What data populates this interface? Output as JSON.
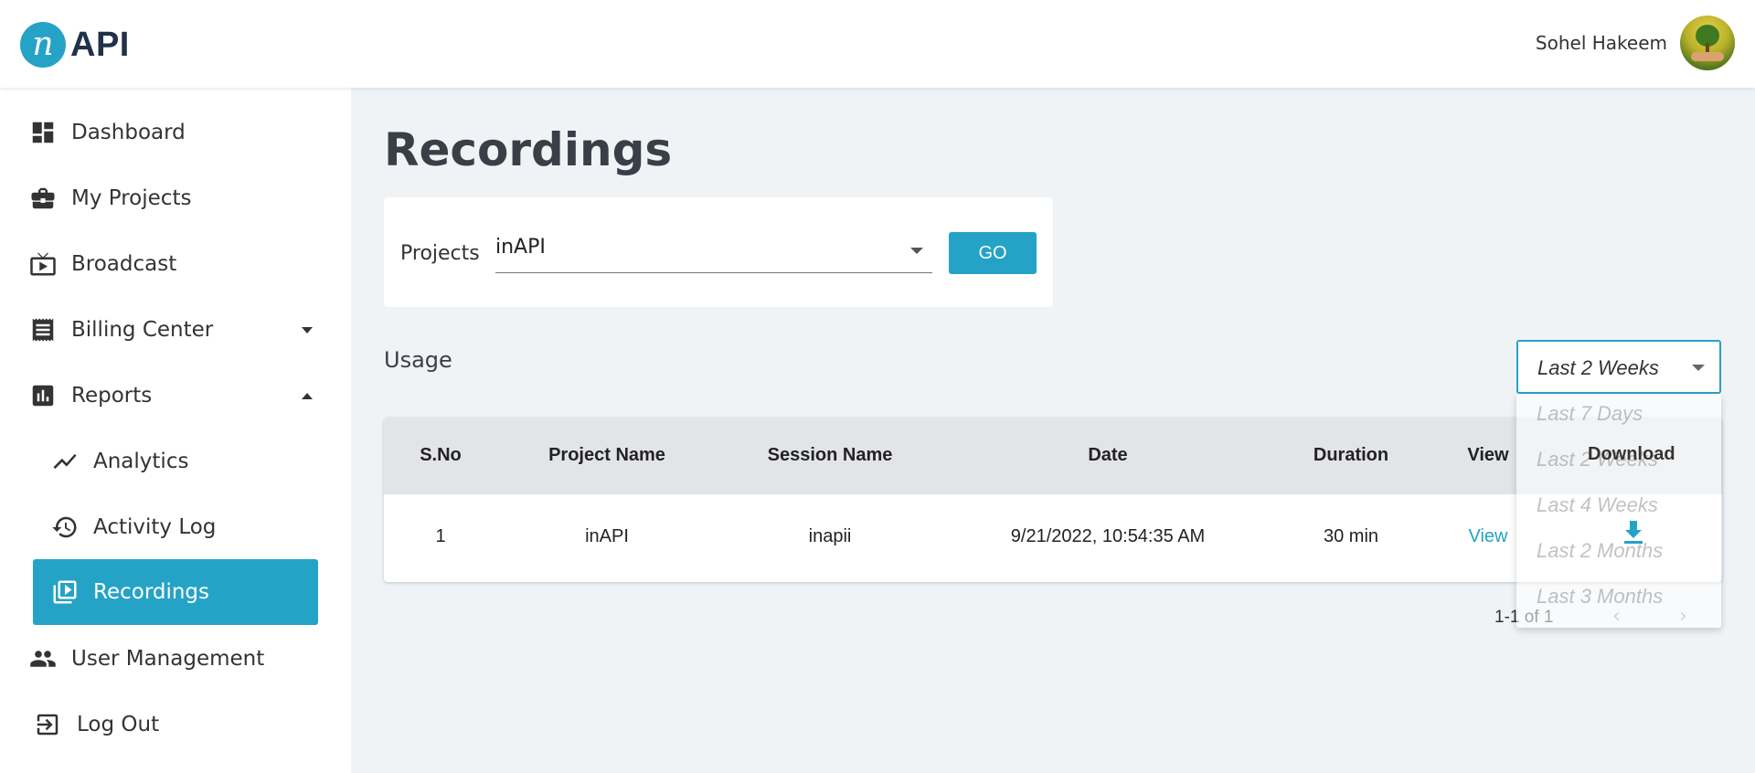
{
  "header": {
    "logo_letter": "n",
    "logo_text": "API",
    "user_name": "Sohel Hakeem"
  },
  "sidebar": {
    "items": [
      {
        "label": "Dashboard",
        "icon": "dashboard-icon"
      },
      {
        "label": "My Projects",
        "icon": "briefcase-icon"
      },
      {
        "label": "Broadcast",
        "icon": "tv-icon"
      },
      {
        "label": "Billing Center",
        "icon": "receipt-icon",
        "expanded": false
      },
      {
        "label": "Reports",
        "icon": "bar-chart-icon",
        "expanded": true
      },
      {
        "label": "Analytics",
        "icon": "trending-icon"
      },
      {
        "label": "Activity Log",
        "icon": "history-icon"
      },
      {
        "label": "Recordings",
        "icon": "video-library-icon",
        "active": true
      },
      {
        "label": "User Management",
        "icon": "people-icon"
      },
      {
        "label": "Log Out",
        "icon": "logout-icon"
      }
    ]
  },
  "main": {
    "title": "Recordings",
    "filter": {
      "label": "Projects",
      "selected": "inAPI",
      "go_label": "GO"
    },
    "usage_title": "Usage",
    "range": {
      "selected": "Last 2 Weeks",
      "options": [
        "Last 7 Days",
        "Last 2 Weeks",
        "Last 4 Weeks",
        "Last 2 Months",
        "Last 3 Months"
      ]
    },
    "table": {
      "columns": [
        "S.No",
        "Project Name",
        "Session Name",
        "Date",
        "Duration",
        "View"
      ],
      "download_label": "Download",
      "rows": [
        {
          "sno": "1",
          "project": "inAPI",
          "session": "inapii",
          "date": "9/21/2022, 10:54:35 AM",
          "duration": "30 min",
          "view": "View"
        }
      ]
    },
    "pagination": {
      "text": "1-1 of 1",
      "prev": "‹",
      "next": "›"
    }
  },
  "colors": {
    "accent": "#25a3c6",
    "page_bg": "#eff3f6",
    "header_bg": "#e2e4e8"
  }
}
